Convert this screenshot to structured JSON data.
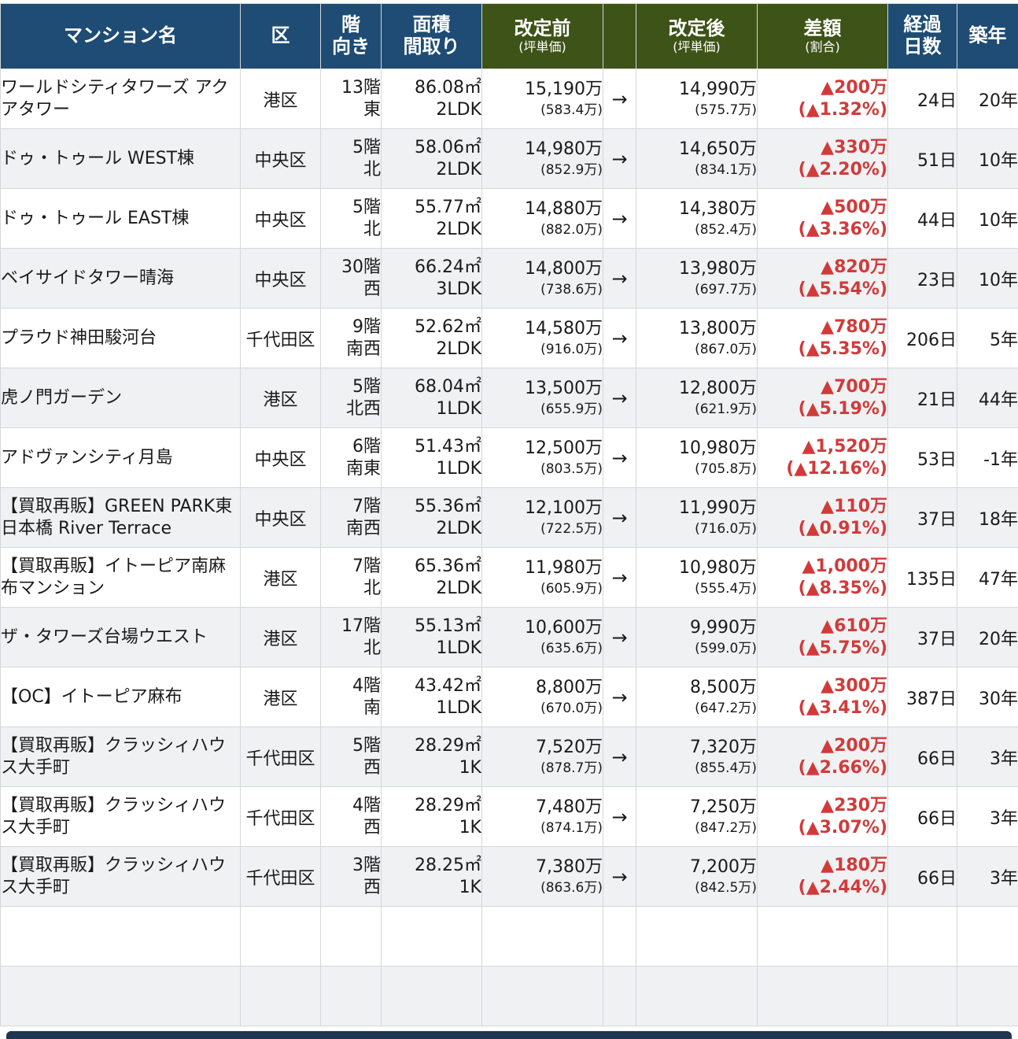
{
  "headers": {
    "name": "マンション名",
    "ward": "区",
    "floor_line1": "階",
    "floor_line2": "向き",
    "area_line1": "面積",
    "area_line2": "間取り",
    "before_main": "改定前",
    "before_sub": "(坪単価)",
    "after_main": "改定後",
    "after_sub": "(坪単価)",
    "diff_main": "差額",
    "diff_sub": "(割合)",
    "days_line1": "経過",
    "days_line2": "日数",
    "age": "築年"
  },
  "arrow": "→",
  "rows": [
    {
      "name": "ワールドシティタワーズ アクアタワー",
      "ward": "港区",
      "floor": "13階",
      "direction": "東",
      "area": "86.08㎡",
      "layout": "2LDK",
      "before": "15,190万",
      "before_unit": "(583.4万)",
      "after": "14,990万",
      "after_unit": "(575.7万)",
      "diff": "▲200万",
      "diff_pct": "(▲1.32%)",
      "days": "24日",
      "age": "20年"
    },
    {
      "name": "ドゥ・トゥール WEST棟",
      "ward": "中央区",
      "floor": "5階",
      "direction": "北",
      "area": "58.06㎡",
      "layout": "2LDK",
      "before": "14,980万",
      "before_unit": "(852.9万)",
      "after": "14,650万",
      "after_unit": "(834.1万)",
      "diff": "▲330万",
      "diff_pct": "(▲2.20%)",
      "days": "51日",
      "age": "10年"
    },
    {
      "name": "ドゥ・トゥール EAST棟",
      "ward": "中央区",
      "floor": "5階",
      "direction": "北",
      "area": "55.77㎡",
      "layout": "2LDK",
      "before": "14,880万",
      "before_unit": "(882.0万)",
      "after": "14,380万",
      "after_unit": "(852.4万)",
      "diff": "▲500万",
      "diff_pct": "(▲3.36%)",
      "days": "44日",
      "age": "10年"
    },
    {
      "name": "ベイサイドタワー晴海",
      "ward": "中央区",
      "floor": "30階",
      "direction": "西",
      "area": "66.24㎡",
      "layout": "3LDK",
      "before": "14,800万",
      "before_unit": "(738.6万)",
      "after": "13,980万",
      "after_unit": "(697.7万)",
      "diff": "▲820万",
      "diff_pct": "(▲5.54%)",
      "days": "23日",
      "age": "10年"
    },
    {
      "name": "プラウド神田駿河台",
      "ward": "千代田区",
      "floor": "9階",
      "direction": "南西",
      "area": "52.62㎡",
      "layout": "2LDK",
      "before": "14,580万",
      "before_unit": "(916.0万)",
      "after": "13,800万",
      "after_unit": "(867.0万)",
      "diff": "▲780万",
      "diff_pct": "(▲5.35%)",
      "days": "206日",
      "age": "5年"
    },
    {
      "name": "虎ノ門ガーデン",
      "ward": "港区",
      "floor": "5階",
      "direction": "北西",
      "area": "68.04㎡",
      "layout": "1LDK",
      "before": "13,500万",
      "before_unit": "(655.9万)",
      "after": "12,800万",
      "after_unit": "(621.9万)",
      "diff": "▲700万",
      "diff_pct": "(▲5.19%)",
      "days": "21日",
      "age": "44年"
    },
    {
      "name": "アドヴァンシティ月島",
      "ward": "中央区",
      "floor": "6階",
      "direction": "南東",
      "area": "51.43㎡",
      "layout": "1LDK",
      "before": "12,500万",
      "before_unit": "(803.5万)",
      "after": "10,980万",
      "after_unit": "(705.8万)",
      "diff": "▲1,520万",
      "diff_pct": "(▲12.16%)",
      "days": "53日",
      "age": "-1年"
    },
    {
      "name": "【買取再販】GREEN PARK東日本橋 River Terrace",
      "ward": "中央区",
      "floor": "7階",
      "direction": "南西",
      "area": "55.36㎡",
      "layout": "2LDK",
      "before": "12,100万",
      "before_unit": "(722.5万)",
      "after": "11,990万",
      "after_unit": "(716.0万)",
      "diff": "▲110万",
      "diff_pct": "(▲0.91%)",
      "days": "37日",
      "age": "18年"
    },
    {
      "name": "【買取再販】イトーピア南麻布マンション",
      "ward": "港区",
      "floor": "7階",
      "direction": "北",
      "area": "65.36㎡",
      "layout": "2LDK",
      "before": "11,980万",
      "before_unit": "(605.9万)",
      "after": "10,980万",
      "after_unit": "(555.4万)",
      "diff": "▲1,000万",
      "diff_pct": "(▲8.35%)",
      "days": "135日",
      "age": "47年"
    },
    {
      "name": "ザ・タワーズ台場ウエスト",
      "ward": "港区",
      "floor": "17階",
      "direction": "北",
      "area": "55.13㎡",
      "layout": "1LDK",
      "before": "10,600万",
      "before_unit": "(635.6万)",
      "after": "9,990万",
      "after_unit": "(599.0万)",
      "diff": "▲610万",
      "diff_pct": "(▲5.75%)",
      "days": "37日",
      "age": "20年"
    },
    {
      "name": "【OC】イトーピア麻布",
      "ward": "港区",
      "floor": "4階",
      "direction": "南",
      "area": "43.42㎡",
      "layout": "1LDK",
      "before": "8,800万",
      "before_unit": "(670.0万)",
      "after": "8,500万",
      "after_unit": "(647.2万)",
      "diff": "▲300万",
      "diff_pct": "(▲3.41%)",
      "days": "387日",
      "age": "30年"
    },
    {
      "name": "【買取再販】クラッシィハウス大手町",
      "ward": "千代田区",
      "floor": "5階",
      "direction": "西",
      "area": "28.29㎡",
      "layout": "1K",
      "before": "7,520万",
      "before_unit": "(878.7万)",
      "after": "7,320万",
      "after_unit": "(855.4万)",
      "diff": "▲200万",
      "diff_pct": "(▲2.66%)",
      "days": "66日",
      "age": "3年"
    },
    {
      "name": "【買取再販】クラッシィハウス大手町",
      "ward": "千代田区",
      "floor": "4階",
      "direction": "西",
      "area": "28.29㎡",
      "layout": "1K",
      "before": "7,480万",
      "before_unit": "(874.1万)",
      "after": "7,250万",
      "after_unit": "(847.2万)",
      "diff": "▲230万",
      "diff_pct": "(▲3.07%)",
      "days": "66日",
      "age": "3年"
    },
    {
      "name": "【買取再販】クラッシィハウス大手町",
      "ward": "千代田区",
      "floor": "3階",
      "direction": "西",
      "area": "28.25㎡",
      "layout": "1K",
      "before": "7,380万",
      "before_unit": "(863.6万)",
      "after": "7,200万",
      "after_unit": "(842.5万)",
      "diff": "▲180万",
      "diff_pct": "(▲2.44%)",
      "days": "66日",
      "age": "3年"
    }
  ]
}
